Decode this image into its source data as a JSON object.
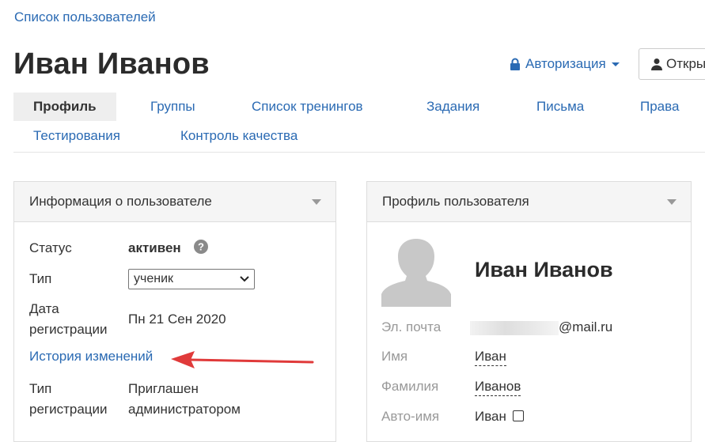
{
  "breadcrumb": {
    "label": "Список пользователей"
  },
  "header": {
    "title": "Иван Иванов",
    "auth_label": "Авторизация",
    "open_label": "Откры"
  },
  "tabs": [
    {
      "label": "Профиль",
      "active": true
    },
    {
      "label": "Группы"
    },
    {
      "label": "Список тренингов"
    },
    {
      "label": "Задания"
    },
    {
      "label": "Письма"
    },
    {
      "label": "Права"
    },
    {
      "label": "Тестирования"
    },
    {
      "label": "Контроль качества"
    }
  ],
  "info_panel": {
    "title": "Информация о пользователе",
    "status_label": "Статус",
    "status_value": "активен",
    "type_label": "Тип",
    "type_value": "ученик",
    "reg_date_label_1": "Дата",
    "reg_date_label_2": "регистрации",
    "reg_date_value": "Пн 21 Сен 2020",
    "history_link": "История изменений",
    "reg_type_label_1": "Тип",
    "reg_type_label_2": "регистрации",
    "reg_type_value_1": "Приглашен",
    "reg_type_value_2": "администратором"
  },
  "profile_panel": {
    "title": "Профиль пользователя",
    "name": "Иван Иванов",
    "email_label": "Эл. почта",
    "email_suffix": "@mail.ru",
    "first_name_label": "Имя",
    "first_name_value": "Иван",
    "last_name_label": "Фамилия",
    "last_name_value": "Иванов",
    "autoname_label": "Авто-имя",
    "autoname_value": "Иван"
  },
  "colors": {
    "link": "#2a6ab3",
    "annotation_arrow": "#e03a3a"
  }
}
